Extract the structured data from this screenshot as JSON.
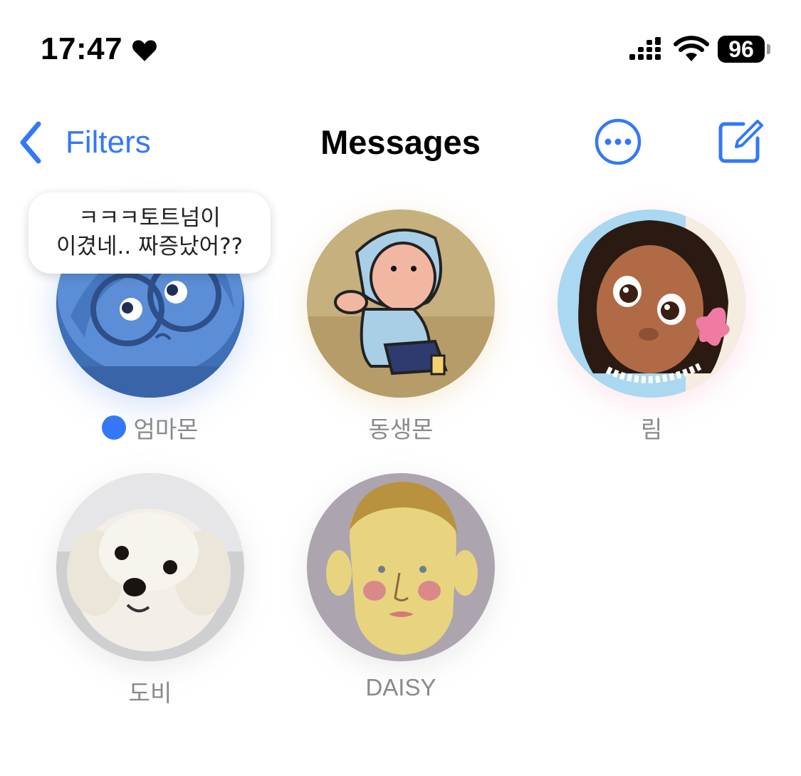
{
  "status_bar": {
    "time": "17:47",
    "battery": "96"
  },
  "nav": {
    "back_label": "Filters",
    "title": "Messages"
  },
  "pinned": [
    {
      "name": "엄마몬",
      "unread": true,
      "message_preview_line1": "ㅋㅋㅋ토트넘이",
      "message_preview_line2": "이겼네.. 짜증났어??"
    },
    {
      "name": "동생몬"
    },
    {
      "name": "림"
    },
    {
      "name": "도비"
    },
    {
      "name": "DAISY"
    }
  ],
  "colors": {
    "accent": "#3478f6",
    "secondary_text": "#8a8a8e"
  },
  "icons": [
    "heart-icon",
    "cellular-signal-icon",
    "wifi-icon",
    "battery-icon",
    "chevron-left-icon",
    "ellipsis-circle-icon",
    "compose-icon"
  ]
}
